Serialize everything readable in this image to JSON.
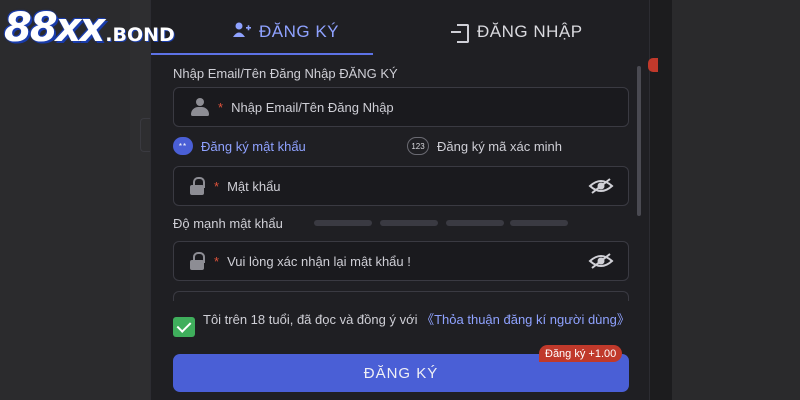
{
  "logo": {
    "main": "88xx",
    "suffix": ".BOND"
  },
  "tabs": {
    "register": "ĐĂNG KÝ",
    "login": "ĐĂNG NHẬP"
  },
  "form": {
    "account_label": "Nhập Email/Tên Đăng Nhập ĐĂNG KÝ",
    "required_mark": "*",
    "email_placeholder": "Nhập Email/Tên Đăng Nhập",
    "options": {
      "password_badge": "**",
      "password_label": "Đăng ký mật khẩu",
      "code_badge": "123",
      "code_label": "Đăng ký mã xác minh"
    },
    "password_placeholder": "Mật khẩu",
    "strength_label": "Độ mạnh mật khẩu",
    "strength_level": 0,
    "confirm_placeholder": "Vui lòng xác nhận lại mật khẩu !",
    "agree_text": "Tôi trên 18 tuổi, đã đọc và đồng ý với",
    "agree_link": "《Thỏa thuận đăng kí người dùng》",
    "agree_checked": true,
    "submit_label": "ĐĂNG KÝ",
    "bonus_badge": "Đăng ký +1.00"
  },
  "icons": {
    "user": "user-icon",
    "lock": "lock-icon",
    "eye": "eye-slash-icon",
    "login": "login-icon",
    "add_user": "add-user-icon",
    "check": "check-icon"
  },
  "colors": {
    "accent": "#4a5fd6",
    "accent_text": "#8fa2ff",
    "required": "#e0533b",
    "check": "#3fae5c",
    "badge": "#c0392b"
  }
}
